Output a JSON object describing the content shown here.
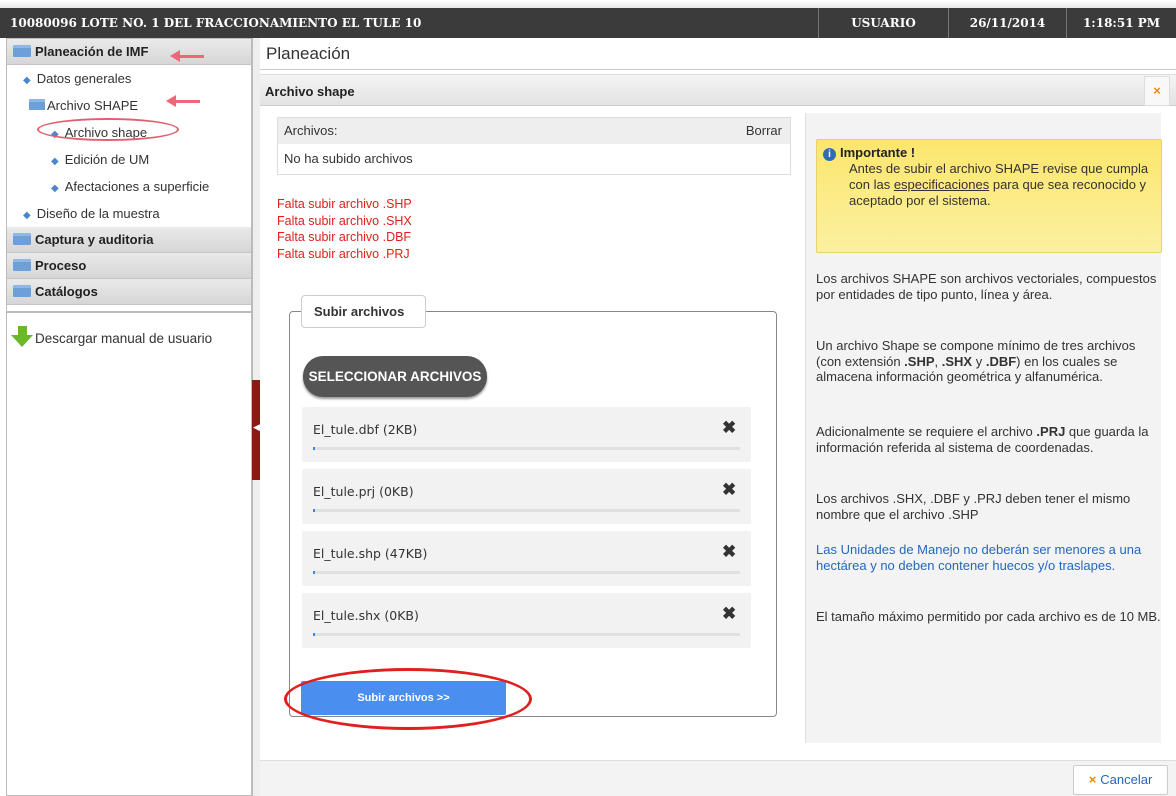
{
  "topbar": {
    "title": "10080096 LOTE NO. 1 DEL FRACCIONAMIENTO EL TULE 10",
    "user": "USUARIO",
    "date": "26/11/2014",
    "time": "1:18:51 PM"
  },
  "sidebar": {
    "group1": "Planeación de IMF",
    "item_datos": "Datos generales",
    "subgroup": "Archivo SHAPE",
    "item_archivo": "Archivo shape",
    "item_edicion": "Edición de UM",
    "item_afectaciones": "Afectaciones a superficie",
    "item_diseno": "Diseño de la muestra",
    "group2": "Captura y auditoria",
    "group3": "Proceso",
    "group4": "Catálogos",
    "download": "Descargar manual de usuario"
  },
  "main": {
    "page_title": "Planeación",
    "panel_title": "Archivo shape",
    "close_glyph": "×"
  },
  "files_table": {
    "col_files": "Archivos:",
    "col_delete": "Borrar",
    "empty": "No ha subido archivos"
  },
  "errors": [
    "Falta subir archivo .SHP",
    "Falta subir archivo .SHX",
    "Falta subir archivo .DBF",
    "Falta subir archivo .PRJ"
  ],
  "upload": {
    "legend": "Subir archivos",
    "select_button": "SELECCIONAR ARCHIVOS",
    "files": [
      {
        "name": "El_tule.dbf (2KB)",
        "progress": 0
      },
      {
        "name": "El_tule.prj (0KB)",
        "progress": 0
      },
      {
        "name": "El_tule.shp (47KB)",
        "progress": 0
      },
      {
        "name": "El_tule.shx (0KB)",
        "progress": 0
      }
    ],
    "remove_glyph": "✖",
    "submit_button": "Subir archivos >>"
  },
  "notice": {
    "heading": "Importante !",
    "text_before": "Antes de subir el archivo SHAPE revise que cumpla con las",
    "link": "especificaciones",
    "text_after": "para que sea reconocido y aceptado por el sistema."
  },
  "info": {
    "p1": "Los archivos SHAPE son archivos vectoriales, compuestos por entidades de tipo punto, línea y área.",
    "p2_a": "Un archivo Shape se compone mínimo de tres archivos (con extensión ",
    "p2_shp": ".SHP",
    "p2_sep1": ", ",
    "p2_shx": ".SHX",
    "p2_sep2": " y ",
    "p2_dbf": ".DBF",
    "p2_b": ") en los cuales se almacena información geométrica y alfanumérica.",
    "p3_a": "Adicionalmente se requiere el archivo ",
    "p3_prj": ".PRJ",
    "p3_b": " que guarda la información referida al sistema de coordenadas.",
    "p4": "Los archivos .SHX, .DBF y .PRJ deben tener el mismo nombre que el archivo .SHP",
    "p5": "Las Unidades de Manejo no deberán ser menores a una hectárea y no deben contener huecos y/o traslapes.",
    "p6": "El tamaño máximo permitido por cada archivo es de 10 MB."
  },
  "footer": {
    "cancel": "Cancelar",
    "cancel_glyph": "×"
  },
  "colors": {
    "accent_blue": "#4a8ef0",
    "error_red": "#e0201b",
    "annotation_red": "#e02020",
    "notice_yellow": "#fce66e"
  }
}
